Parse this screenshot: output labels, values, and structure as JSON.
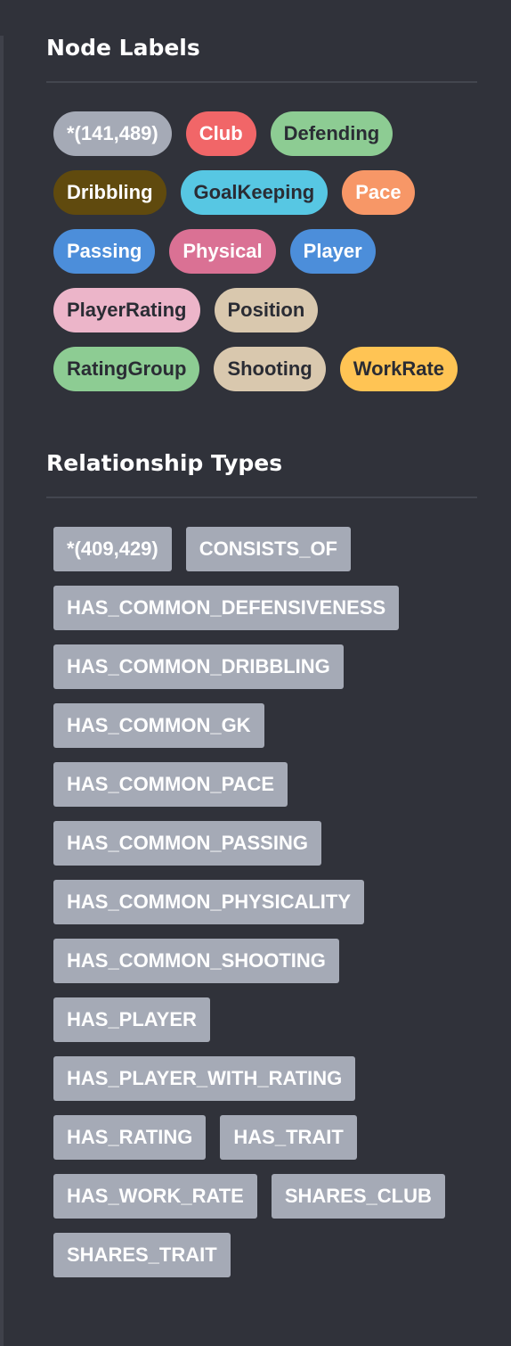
{
  "node_labels": {
    "title": "Node Labels",
    "items": [
      {
        "label": "*(141,489)",
        "bg": "#a5aab6",
        "fg": "#ffffff"
      },
      {
        "label": "Club",
        "bg": "#f16668",
        "fg": "#ffffff"
      },
      {
        "label": "Defending",
        "bg": "#8dcc93",
        "fg": "#2a2c34"
      },
      {
        "label": "Dribbling",
        "bg": "#604a0e",
        "fg": "#ffffff"
      },
      {
        "label": "GoalKeeping",
        "bg": "#57c7e3",
        "fg": "#2a2c34"
      },
      {
        "label": "Pace",
        "bg": "#f79767",
        "fg": "#ffffff"
      },
      {
        "label": "Passing",
        "bg": "#4c8eda",
        "fg": "#ffffff"
      },
      {
        "label": "Physical",
        "bg": "#da7194",
        "fg": "#ffffff"
      },
      {
        "label": "Player",
        "bg": "#4c8eda",
        "fg": "#ffffff"
      },
      {
        "label": "PlayerRating",
        "bg": "#ecb5c9",
        "fg": "#2a2c34"
      },
      {
        "label": "Position",
        "bg": "#d9c8ae",
        "fg": "#2a2c34"
      },
      {
        "label": "RatingGroup",
        "bg": "#8dcc93",
        "fg": "#2a2c34"
      },
      {
        "label": "Shooting",
        "bg": "#d9c8ae",
        "fg": "#2a2c34"
      },
      {
        "label": "WorkRate",
        "bg": "#ffc454",
        "fg": "#2a2c34"
      }
    ]
  },
  "relationship_types": {
    "title": "Relationship Types",
    "items": [
      "*(409,429)",
      "CONSISTS_OF",
      "HAS_COMMON_DEFENSIVENESS",
      "HAS_COMMON_DRIBBLING",
      "HAS_COMMON_GK",
      "HAS_COMMON_PACE",
      "HAS_COMMON_PASSING",
      "HAS_COMMON_PHYSICALITY",
      "HAS_COMMON_SHOOTING",
      "HAS_PLAYER",
      "HAS_PLAYER_WITH_RATING",
      "HAS_RATING",
      "HAS_TRAIT",
      "HAS_WORK_RATE",
      "SHARES_CLUB",
      "SHARES_TRAIT"
    ]
  }
}
